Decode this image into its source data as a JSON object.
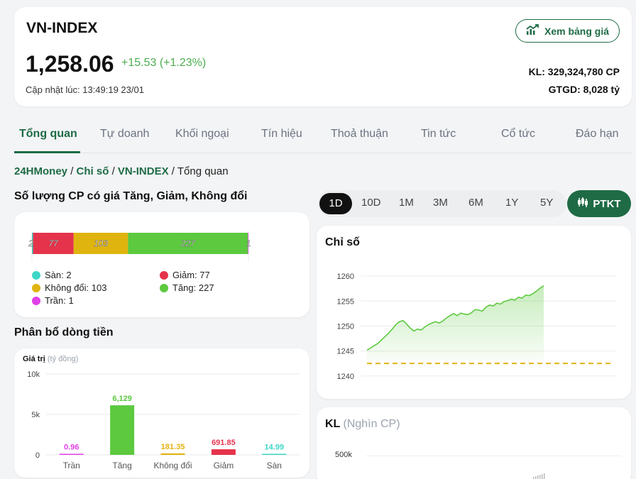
{
  "header": {
    "index_name": "VN-INDEX",
    "price": "1,258.06",
    "change": "+15.53 (+1.23%)",
    "updated": "Cập nhật lúc: 13:49:19 23/01",
    "board_button": "Xem bảng giá",
    "kl": "KL: 329,324,780 CP",
    "gtgd": "GTGD: 8,028 tỷ"
  },
  "tabs": [
    "Tổng quan",
    "Tự doanh",
    "Khối ngoại",
    "Tín hiệu",
    "Thoả thuận",
    "Tin tức",
    "Cổ tức",
    "Đáo hạn"
  ],
  "breadcrumb": {
    "home": "24HMoney",
    "section": "Chỉ số",
    "index": "VN-INDEX",
    "sep": "/",
    "current": "Tổng quan"
  },
  "breadth": {
    "title": "Số lượng CP có giá Tăng, Giảm, Không đổi",
    "segments": [
      {
        "label": "Sàn",
        "value": 2,
        "color": "#3dd6c6"
      },
      {
        "label": "Giảm",
        "value": 77,
        "color": "#e5334b"
      },
      {
        "label": "Không đổi",
        "value": 103,
        "color": "#e0b40e"
      },
      {
        "label": "Tăng",
        "value": 227,
        "color": "#5cc93f"
      },
      {
        "label": "Trần",
        "value": 1,
        "color": "#e040e8"
      }
    ],
    "legend": {
      "floor": "Sàn: 2",
      "down": "Giảm: 77",
      "unchanged": "Không đổi: 103",
      "up": "Tăng: 227",
      "ceiling": "Trần: 1"
    }
  },
  "flow": {
    "title": "Phân bổ dòng tiền",
    "ylabel": "Giá trị",
    "yunit": "(tỷ đồng)"
  },
  "periods": [
    "1D",
    "10D",
    "1M",
    "3M",
    "6M",
    "1Y",
    "5Y"
  ],
  "ptkt_label": "PTKT",
  "index_chart": {
    "title": "Chỉ số"
  },
  "volume_chart": {
    "title": "KL",
    "unit": "(Nghìn CP)",
    "tick": "500k"
  },
  "colors": {
    "brand": "#1e6b45",
    "up": "#5cc93f",
    "down": "#e5334b",
    "ref": "#e0b40e",
    "ceiling": "#e040e8",
    "floor": "#3dd6c6"
  },
  "chart_data": [
    {
      "type": "bar",
      "title": "Phân bổ dòng tiền",
      "ylabel": "Giá trị (tỷ đồng)",
      "categories": [
        "Trần",
        "Tăng",
        "Không đổi",
        "Giảm",
        "Sàn"
      ],
      "values": [
        0.96,
        6129,
        181.35,
        691.85,
        14.99
      ],
      "value_labels": [
        "0.96",
        "6,129",
        "181.35",
        "691.85",
        "14.99"
      ],
      "colors": [
        "#e040e8",
        "#5cc93f",
        "#e0b40e",
        "#e5334b",
        "#3dd6c6"
      ],
      "ylim": [
        0,
        10000
      ],
      "yticks": [
        0,
        5000,
        10000
      ],
      "ytick_labels": [
        "0",
        "5k",
        "10k"
      ]
    },
    {
      "type": "area",
      "title": "Chỉ số",
      "ylim": [
        1238,
        1262
      ],
      "yticks": [
        1240,
        1245,
        1250,
        1255,
        1260
      ],
      "reference": 1242.53,
      "values": [
        1245.2,
        1245.6,
        1246.1,
        1246.5,
        1247.2,
        1247.9,
        1248.6,
        1249.4,
        1250.3,
        1250.9,
        1251.1,
        1250.4,
        1249.6,
        1249.0,
        1249.4,
        1249.2,
        1249.8,
        1250.3,
        1250.6,
        1250.9,
        1250.6,
        1251.0,
        1251.6,
        1252.1,
        1252.5,
        1252.1,
        1252.6,
        1252.4,
        1252.3,
        1252.7,
        1253.3,
        1253.2,
        1253.0,
        1253.8,
        1254.2,
        1254.0,
        1254.6,
        1254.4,
        1254.9,
        1255.1,
        1255.4,
        1255.2,
        1255.8,
        1255.6,
        1256.2,
        1256.1,
        1256.5,
        1257.0,
        1257.6,
        1258.06
      ]
    }
  ]
}
